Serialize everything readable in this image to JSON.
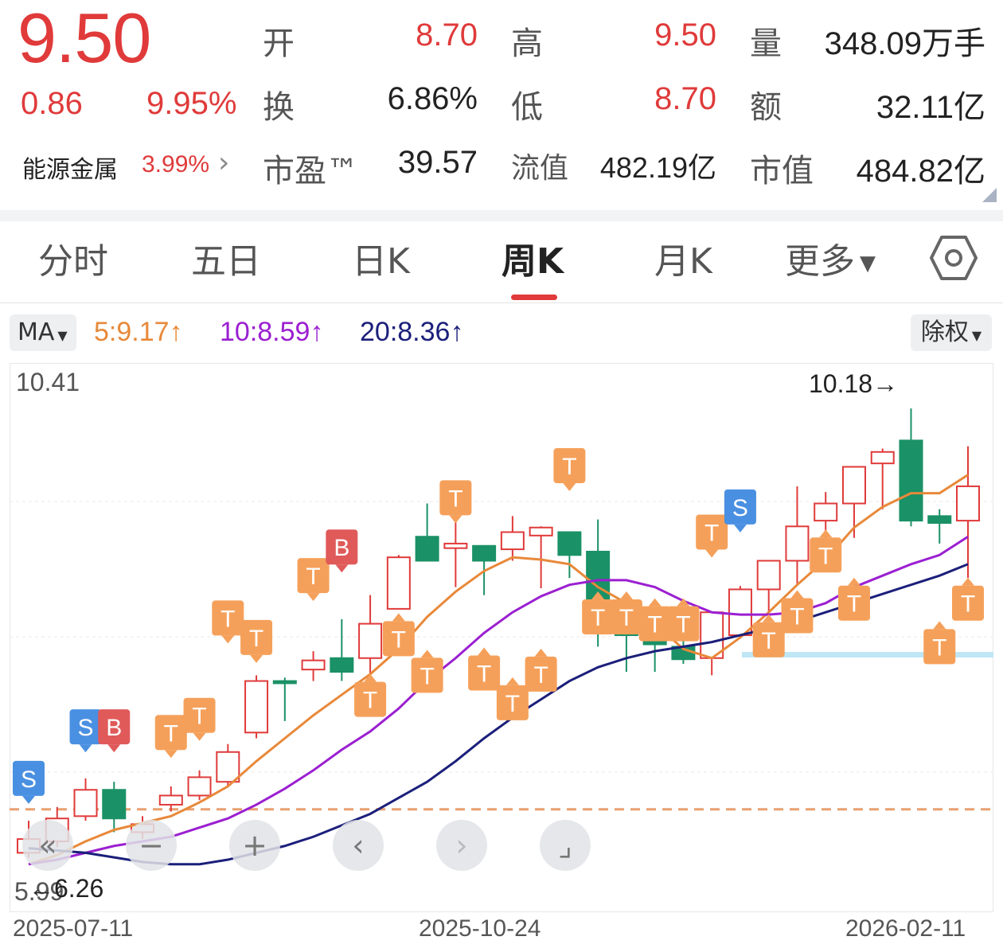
{
  "quote": {
    "price": "9.50",
    "change": "0.86",
    "change_pct": "9.95%",
    "fields": [
      {
        "label": "开",
        "value": "8.70",
        "color": "red"
      },
      {
        "label": "高",
        "value": "9.50",
        "color": "red"
      },
      {
        "label": "量",
        "value": "348.09万手",
        "color": "dark"
      },
      {
        "label": "换",
        "value": "6.86%",
        "color": "dark"
      },
      {
        "label": "低",
        "value": "8.70",
        "color": "red"
      },
      {
        "label": "额",
        "value": "32.11亿",
        "color": "dark"
      },
      {
        "label": "市盈™",
        "value": "39.57",
        "color": "dark"
      },
      {
        "label": "流值",
        "value": "482.19亿",
        "color": "dark"
      },
      {
        "label": "市值",
        "value": "484.82亿",
        "color": "dark"
      }
    ],
    "sector": {
      "name": "能源金属",
      "pct": "3.99%"
    }
  },
  "tabs": [
    {
      "label": "分时",
      "active": false
    },
    {
      "label": "五日",
      "active": false
    },
    {
      "label": "日K",
      "active": false
    },
    {
      "label": "周K",
      "active": true
    },
    {
      "label": "月K",
      "active": false
    },
    {
      "label": "更多",
      "active": false
    }
  ],
  "ma_bar": {
    "selector": "MA",
    "items": [
      {
        "text": "5:9.17↑",
        "color": "#e8893a"
      },
      {
        "text": "10:8.59↑",
        "color": "#9b1fd1"
      },
      {
        "text": "20:8.36↑",
        "color": "#1b1f7a"
      }
    ],
    "adjust": "除权"
  },
  "colors": {
    "up": "#e03a3a",
    "down": "#1a9166",
    "ma5": "#e8893a",
    "ma10": "#9b1fd1",
    "ma20": "#1b1f7a",
    "signal_t": "#f5a05a",
    "signal_s": "#4a90e2",
    "signal_b": "#e05a5a"
  },
  "chart_data": {
    "type": "candlestick",
    "axis_max_label": "10.41",
    "axis_min_label": "5.99",
    "ylim": [
      5.99,
      10.41
    ],
    "max_marker": "10.18→",
    "min_marker": "←6.26",
    "x_labels": [
      "2025-07-11",
      "2025-10-24",
      "2026-02-11"
    ],
    "candles": [
      {
        "o": 6.3,
        "h": 6.58,
        "l": 6.26,
        "c": 6.42
      },
      {
        "o": 6.4,
        "h": 6.7,
        "l": 6.35,
        "c": 6.6
      },
      {
        "o": 6.62,
        "h": 6.95,
        "l": 6.58,
        "c": 6.85
      },
      {
        "o": 6.85,
        "h": 6.92,
        "l": 6.48,
        "c": 6.6
      },
      {
        "o": 6.48,
        "h": 6.62,
        "l": 6.42,
        "c": 6.55
      },
      {
        "o": 6.72,
        "h": 6.88,
        "l": 6.66,
        "c": 6.8
      },
      {
        "o": 6.8,
        "h": 7.02,
        "l": 6.76,
        "c": 6.96
      },
      {
        "o": 6.92,
        "h": 7.25,
        "l": 6.88,
        "c": 7.18
      },
      {
        "o": 7.35,
        "h": 7.85,
        "l": 7.3,
        "c": 7.8
      },
      {
        "o": 7.8,
        "h": 7.83,
        "l": 7.45,
        "c": 7.78
      },
      {
        "o": 7.9,
        "h": 8.06,
        "l": 7.8,
        "c": 7.98
      },
      {
        "o": 8.0,
        "h": 8.34,
        "l": 7.8,
        "c": 7.88
      },
      {
        "o": 8.0,
        "h": 8.55,
        "l": 7.78,
        "c": 8.3
      },
      {
        "o": 8.43,
        "h": 8.9,
        "l": 8.43,
        "c": 8.88
      },
      {
        "o": 9.06,
        "h": 9.35,
        "l": 8.85,
        "c": 8.85
      },
      {
        "o": 8.96,
        "h": 9.36,
        "l": 8.62,
        "c": 9.0
      },
      {
        "o": 8.98,
        "h": 8.98,
        "l": 8.55,
        "c": 8.85
      },
      {
        "o": 8.95,
        "h": 9.24,
        "l": 8.85,
        "c": 9.1
      },
      {
        "o": 9.07,
        "h": 9.15,
        "l": 8.61,
        "c": 9.14
      },
      {
        "o": 9.1,
        "h": 9.1,
        "l": 8.7,
        "c": 8.9
      },
      {
        "o": 8.93,
        "h": 9.21,
        "l": 8.1,
        "c": 8.3
      },
      {
        "o": 8.3,
        "h": 8.3,
        "l": 7.88,
        "c": 8.2
      },
      {
        "o": 8.2,
        "h": 8.3,
        "l": 7.88,
        "c": 8.12
      },
      {
        "o": 8.1,
        "h": 8.18,
        "l": 7.95,
        "c": 7.99
      },
      {
        "o": 8.0,
        "h": 8.08,
        "l": 7.85,
        "c": 8.4
      },
      {
        "o": 8.2,
        "h": 8.63,
        "l": 8.2,
        "c": 8.6
      },
      {
        "o": 8.6,
        "h": 8.6,
        "l": 8.4,
        "c": 8.85
      },
      {
        "o": 8.85,
        "h": 9.5,
        "l": 8.65,
        "c": 9.15
      },
      {
        "o": 9.2,
        "h": 9.45,
        "l": 8.9,
        "c": 9.35
      },
      {
        "o": 9.35,
        "h": 9.55,
        "l": 9.05,
        "c": 9.67
      },
      {
        "o": 9.7,
        "h": 9.83,
        "l": 9.3,
        "c": 9.8
      },
      {
        "o": 9.9,
        "h": 10.18,
        "l": 9.15,
        "c": 9.2
      },
      {
        "o": 9.24,
        "h": 9.3,
        "l": 9.0,
        "c": 9.18
      },
      {
        "o": 9.2,
        "h": 9.85,
        "l": 8.7,
        "c": 9.5
      }
    ],
    "ma5": [
      6.2,
      6.28,
      6.4,
      6.5,
      6.56,
      6.62,
      6.74,
      6.88,
      7.1,
      7.3,
      7.5,
      7.68,
      7.86,
      8.08,
      8.36,
      8.58,
      8.76,
      8.88,
      8.86,
      8.82,
      8.62,
      8.48,
      8.3,
      8.08,
      8.0,
      8.18,
      8.4,
      8.64,
      8.86,
      9.14,
      9.32,
      9.44,
      9.44,
      9.6
    ],
    "ma10": [
      6.2,
      6.24,
      6.3,
      6.36,
      6.4,
      6.44,
      6.52,
      6.6,
      6.72,
      6.86,
      7.02,
      7.2,
      7.36,
      7.56,
      7.8,
      8.0,
      8.22,
      8.4,
      8.54,
      8.64,
      8.68,
      8.68,
      8.62,
      8.5,
      8.4,
      8.38,
      8.38,
      8.4,
      8.48,
      8.62,
      8.72,
      8.82,
      8.9,
      9.06
    ],
    "ma20": [
      6.34,
      6.32,
      6.3,
      6.26,
      6.22,
      6.2,
      6.2,
      6.24,
      6.3,
      6.36,
      6.44,
      6.54,
      6.64,
      6.78,
      6.92,
      7.1,
      7.3,
      7.48,
      7.64,
      7.8,
      7.92,
      8.0,
      8.06,
      8.1,
      8.14,
      8.2,
      8.26,
      8.32,
      8.4,
      8.48,
      8.56,
      8.64,
      8.72,
      8.82
    ],
    "reference_lines": [
      {
        "value": 6.68,
        "style": "dashed",
        "color": "#e8a070"
      },
      {
        "value": 8.03,
        "style": "solid",
        "color": "#bfe6f5"
      }
    ],
    "signals": [
      {
        "i": 0,
        "type": "S",
        "value": 6.95,
        "dir": "up"
      },
      {
        "i": 2,
        "type": "S",
        "value": 7.4,
        "dir": "up"
      },
      {
        "i": 3,
        "type": "B",
        "value": 7.4,
        "dir": "up"
      },
      {
        "i": 5,
        "type": "T",
        "value": 7.35,
        "dir": "up"
      },
      {
        "i": 6,
        "type": "T",
        "value": 7.5,
        "dir": "up"
      },
      {
        "i": 7,
        "type": "T",
        "value": 8.35,
        "dir": "up"
      },
      {
        "i": 8,
        "type": "T",
        "value": 8.18,
        "dir": "up"
      },
      {
        "i": 10,
        "type": "T",
        "value": 8.72,
        "dir": "up"
      },
      {
        "i": 11,
        "type": "B",
        "value": 8.97,
        "dir": "up"
      },
      {
        "i": 12,
        "type": "T",
        "value": 7.64,
        "dir": "down"
      },
      {
        "i": 13,
        "type": "T",
        "value": 8.17,
        "dir": "down"
      },
      {
        "i": 14,
        "type": "T",
        "value": 7.85,
        "dir": "down"
      },
      {
        "i": 15,
        "type": "T",
        "value": 9.4,
        "dir": "up"
      },
      {
        "i": 16,
        "type": "T",
        "value": 7.87,
        "dir": "down"
      },
      {
        "i": 17,
        "type": "T",
        "value": 7.61,
        "dir": "down"
      },
      {
        "i": 18,
        "type": "T",
        "value": 7.86,
        "dir": "down"
      },
      {
        "i": 19,
        "type": "T",
        "value": 9.68,
        "dir": "up"
      },
      {
        "i": 20,
        "type": "T",
        "value": 8.36,
        "dir": "down"
      },
      {
        "i": 21,
        "type": "T",
        "value": 8.36,
        "dir": "down"
      },
      {
        "i": 22,
        "type": "T",
        "value": 8.3,
        "dir": "down"
      },
      {
        "i": 23,
        "type": "T",
        "value": 8.3,
        "dir": "down"
      },
      {
        "i": 24,
        "type": "T",
        "value": 9.1,
        "dir": "up"
      },
      {
        "i": 25,
        "type": "S",
        "value": 9.32,
        "dir": "up"
      },
      {
        "i": 26,
        "type": "T",
        "value": 8.16,
        "dir": "down"
      },
      {
        "i": 27,
        "type": "T",
        "value": 8.37,
        "dir": "down"
      },
      {
        "i": 28,
        "type": "T",
        "value": 8.9,
        "dir": "down"
      },
      {
        "i": 29,
        "type": "T",
        "value": 8.48,
        "dir": "down"
      },
      {
        "i": 32,
        "type": "T",
        "value": 8.1,
        "dir": "down"
      },
      {
        "i": 33,
        "type": "T",
        "value": 8.48,
        "dir": "down"
      }
    ]
  },
  "chart_controls": [
    {
      "name": "scroll-left-far-button",
      "glyph": "«"
    },
    {
      "name": "zoom-out-button",
      "glyph": "−"
    },
    {
      "name": "zoom-in-button",
      "glyph": "+"
    },
    {
      "name": "prev-button",
      "glyph": "‹"
    },
    {
      "name": "next-button",
      "glyph": "›"
    },
    {
      "name": "fullscreen-button",
      "glyph": "⌟"
    }
  ]
}
